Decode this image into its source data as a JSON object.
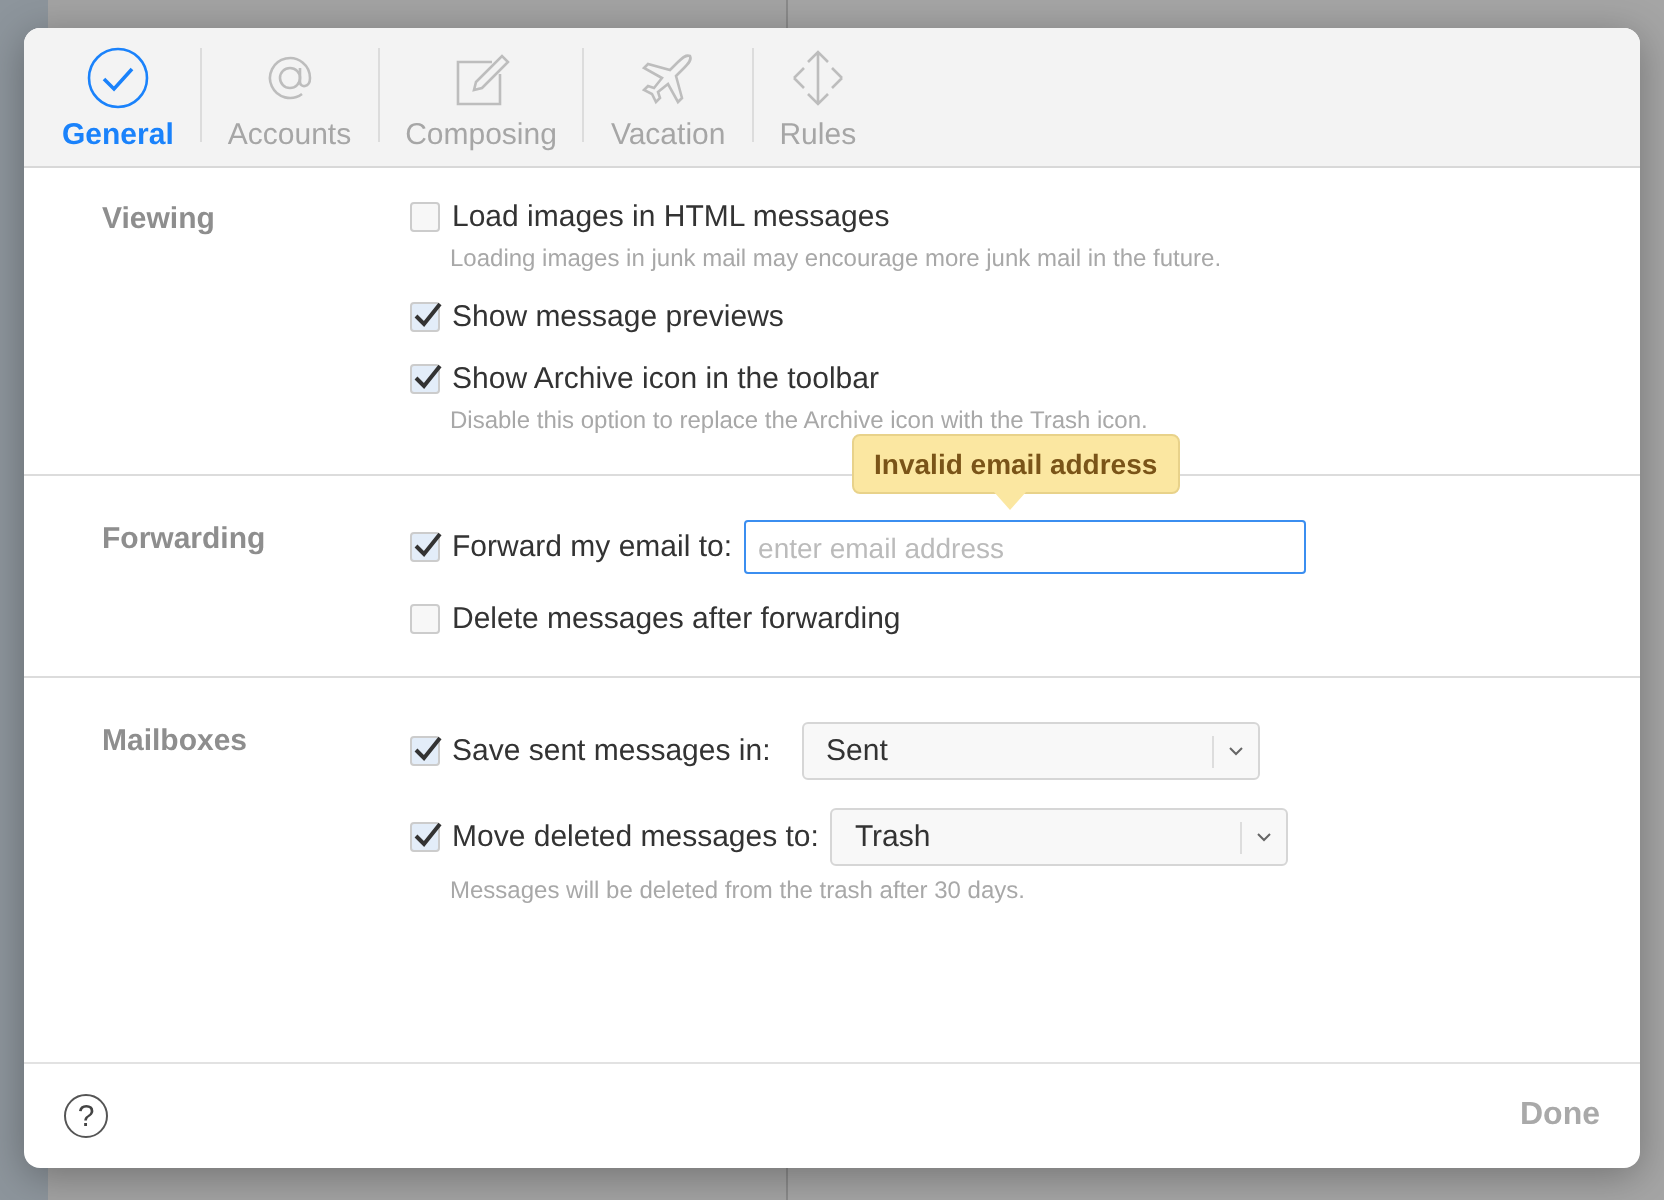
{
  "tabs": [
    {
      "label": "General",
      "selected": true
    },
    {
      "label": "Accounts",
      "selected": false
    },
    {
      "label": "Composing",
      "selected": false
    },
    {
      "label": "Vacation",
      "selected": false
    },
    {
      "label": "Rules",
      "selected": false
    }
  ],
  "sections": [
    {
      "title": "Viewing",
      "rows": [
        {
          "kind": "checkbox",
          "label": "Load images in HTML messages",
          "checked": false,
          "hint": "Loading images in junk mail may encourage more junk mail in the future."
        },
        {
          "kind": "checkbox",
          "label": "Show message previews",
          "checked": true
        },
        {
          "kind": "checkbox",
          "label": "Show Archive icon in the toolbar",
          "checked": true,
          "hint": "Disable this option to replace the Archive icon with the Trash icon."
        }
      ]
    },
    {
      "title": "Forwarding",
      "rows": [
        {
          "kind": "field",
          "label": "Forward my email to:",
          "checked": true,
          "placeholder": "enter email address",
          "error": "Invalid email address"
        },
        {
          "kind": "checkbox",
          "label": "Delete messages after forwarding",
          "checked": false
        }
      ]
    },
    {
      "title": "Mailboxes",
      "rows": [
        {
          "kind": "select",
          "label": "Save sent messages in:",
          "checked": true,
          "value": "Sent"
        },
        {
          "kind": "select",
          "label": "Move deleted messages to:",
          "checked": true,
          "value": "Trash",
          "hint": "Messages will be deleted from the trash after 30 days."
        }
      ]
    }
  ],
  "footer": {
    "help": "?",
    "done": "Done",
    "done_disabled": true
  }
}
